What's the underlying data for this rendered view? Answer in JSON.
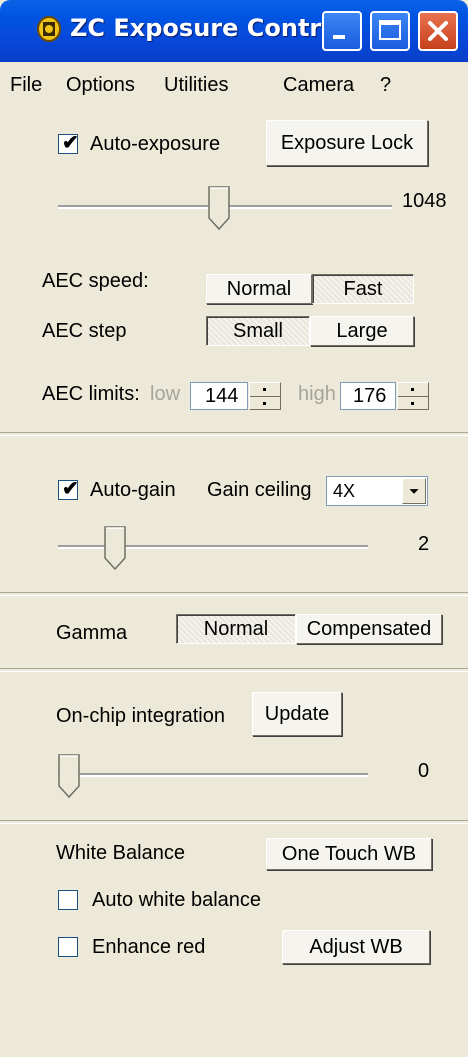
{
  "window": {
    "title": "ZC Exposure Control"
  },
  "menu": [
    "File",
    "Options",
    "Utilities",
    "Camera",
    "?"
  ],
  "exposure": {
    "auto_label": "Auto-exposure",
    "auto_checked": true,
    "lock_button": "Exposure Lock",
    "slider_value": "1048",
    "slider_level": 0.48
  },
  "aec": {
    "speed_label": "AEC speed:",
    "speed_options": [
      "Normal",
      "Fast"
    ],
    "speed_selected": "Fast",
    "step_label": "AEC step",
    "step_options": [
      "Small",
      "Large"
    ],
    "step_selected": "Small",
    "limits_label": "AEC limits:",
    "low_label": "low",
    "low_value": "144",
    "high_label": "high",
    "high_value": "176"
  },
  "gain": {
    "auto_label": "Auto-gain",
    "auto_checked": true,
    "ceiling_label": "Gain ceiling",
    "ceiling_value": "4X",
    "slider_value": "2",
    "slider_level": 0.16
  },
  "gamma": {
    "label": "Gamma",
    "options": [
      "Normal",
      "Compensated"
    ],
    "selected": "Normal"
  },
  "integration": {
    "label": "On-chip integration",
    "update_button": "Update",
    "slider_value": "0",
    "slider_level": 0.0
  },
  "white_balance": {
    "label": "White Balance",
    "one_touch_button": "One Touch WB",
    "auto_label": "Auto white balance",
    "auto_checked": false,
    "enhance_label": "Enhance red",
    "enhance_checked": false,
    "adjust_button": "Adjust WB"
  },
  "colors": {
    "titlebar": "#0a4fdc",
    "window_bg": "#ece9d8",
    "close_button": "#d9542b"
  }
}
